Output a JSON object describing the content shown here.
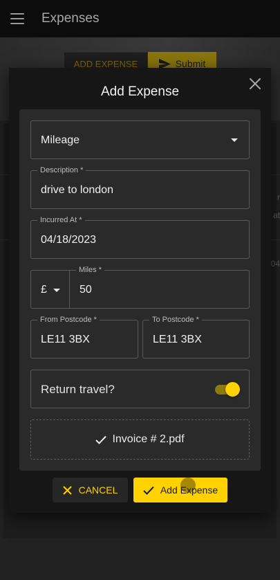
{
  "appbar": {
    "title": "Expenses",
    "menu_icon": "menu-icon"
  },
  "background": {
    "add_expense_label": "ADD EXPENSE",
    "submit_label": "Submit",
    "peek_texts": [
      "r",
      "at",
      "04"
    ]
  },
  "dialog": {
    "title": "Add Expense",
    "type_select": {
      "value": "Mileage"
    },
    "description": {
      "label": "Description *",
      "value": "drive to london"
    },
    "incurred_at": {
      "label": "Incurred At *",
      "value": "04/18/2023"
    },
    "currency": {
      "value": "£"
    },
    "miles": {
      "label": "Miles *",
      "value": "50"
    },
    "from_postcode": {
      "label": "From Postcode *",
      "value": "LE11 3BX"
    },
    "to_postcode": {
      "label": "To Postcode *",
      "value": "LE11 3BX"
    },
    "return_travel": {
      "label": "Return travel?",
      "checked": true
    },
    "attachment": {
      "filename": "Invoice # 2.pdf"
    },
    "cancel_label": "CANCEL",
    "add_label": "Add Expense"
  },
  "colors": {
    "accent": "#ffd200",
    "surface": "#2a2a2a",
    "dialog": "#161616",
    "appbar": "#0c0c0c"
  }
}
